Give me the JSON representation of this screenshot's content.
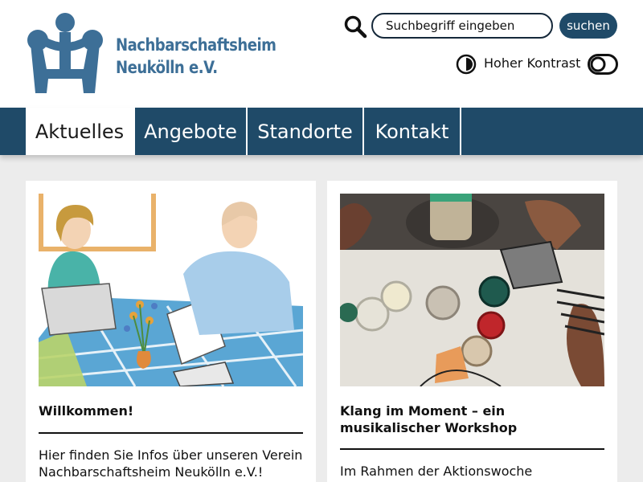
{
  "header": {
    "logo": {
      "line1": "Nachbarschaftsheim",
      "line2": "Neukölln e.V.",
      "color": "#3d6f97"
    },
    "search": {
      "icon": "search-icon",
      "placeholder": "Suchbegriff eingeben",
      "button_label": "suchen"
    },
    "contrast": {
      "icon": "contrast-icon",
      "label": "Hoher Kontrast",
      "toggle_icon": "toggle-icon"
    }
  },
  "nav": {
    "items": [
      {
        "label": "Aktuelles",
        "active": true
      },
      {
        "label": "Angebote",
        "active": false
      },
      {
        "label": "Standorte",
        "active": false
      },
      {
        "label": "Kontakt",
        "active": false
      }
    ]
  },
  "cards": [
    {
      "image": "illustration-two-people-at-table",
      "title": "Willkommen!",
      "text": "Hier finden Sie Infos über unseren Verein Nachbarschaftsheim Neukölln e.V.!"
    },
    {
      "image": "photo-craft-workshop-jars",
      "title": "Klang im Moment – ein musikalischer Workshop",
      "text": "Im Rahmen der Aktionswoche Wundervolle"
    }
  ],
  "colors": {
    "brand": "#1f4a68",
    "logo": "#3d6f97",
    "background": "#ececec"
  }
}
